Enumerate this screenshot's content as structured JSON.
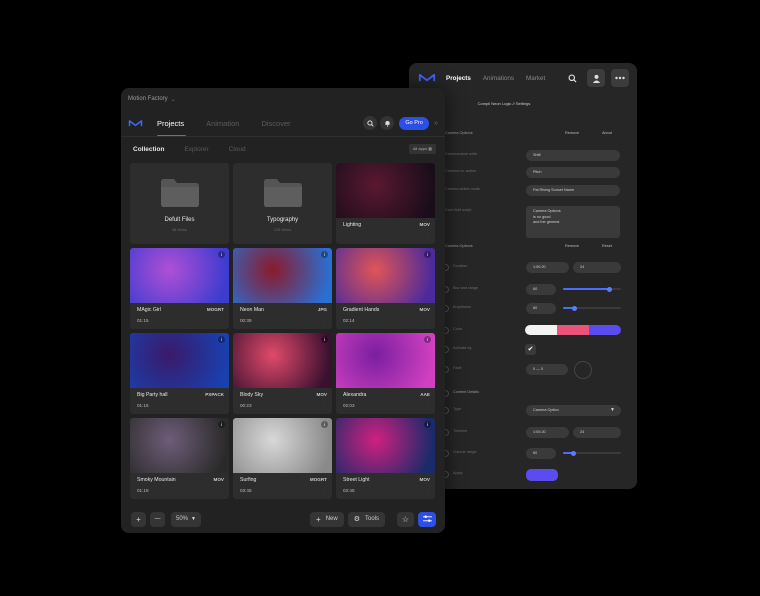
{
  "back_window": {
    "nav": {
      "projects": "Projects",
      "animations": "Animations",
      "market": "Market"
    },
    "subtitle": "Compil Neon Logic // Settings",
    "section1": {
      "title": "Camera Options",
      "tab_a": "Remove",
      "tab_b": "About"
    },
    "fields": [
      {
        "label": "Cameraname write",
        "value": "Shift"
      },
      {
        "label": "Camera no. active",
        "value": "Pitch"
      },
      {
        "label": "Camera active mode",
        "value": "Pal Rising Sunset Name"
      }
    ],
    "textarea": {
      "label": "Cam hold script",
      "lines": [
        "Camera Options",
        "is no good",
        "and the general"
      ]
    },
    "section2": {
      "title": "Camera Options",
      "tab_a": "Remove",
      "tab_b": "Reset"
    },
    "duration": {
      "label": "Duration",
      "a": "1:00:20",
      "b": "24"
    },
    "sliders": [
      {
        "label": "Blur and range",
        "value": "60",
        "fill": 0.8
      },
      {
        "label": "Brightness",
        "value": "60",
        "fill": 0.2
      }
    ],
    "color_label": "Color",
    "swatch_colors": [
      "#f3f3f3",
      "#e9557a",
      "#5a4cf0"
    ],
    "check_label": "Activate by",
    "check_mark": "✔",
    "fade_label": "Fade",
    "fade_value": "0 — 0",
    "section3": {
      "title": "Content Details"
    },
    "type": {
      "label": "Type",
      "value": "Camera Option"
    },
    "timeline": {
      "label": "Timeline",
      "a": "1:00:20",
      "b": "24"
    },
    "slider3": {
      "label": "Volume range",
      "value": "60",
      "fill": 0.18
    },
    "apply_label": "Apply"
  },
  "front_window": {
    "title": "Motion Factory",
    "tabs": {
      "projects": "Projects",
      "animation": "Animation",
      "discover": "Discover"
    },
    "go_pro": "Go Pro",
    "subtabs": {
      "collection": "Collection",
      "explorer": "Explorer",
      "cloud": "Cloud"
    },
    "all_apps": "All apps",
    "folders": [
      {
        "name": "Defult Files",
        "count": "48 Items"
      },
      {
        "name": "Typography",
        "count": "128 Items"
      }
    ],
    "items": [
      {
        "title": "Lighting",
        "format": "MOV",
        "duration": "",
        "c1": "#5a1830",
        "c2": "#1a0d1a"
      },
      {
        "title": "MAgic Girl",
        "format": "MOGRT",
        "duration": "01:15",
        "c1": "#b04fd6",
        "c2": "#3d3ccf"
      },
      {
        "title": "Neon Man",
        "format": "JPG",
        "duration": "00:39",
        "c1": "#8c1a2a",
        "c2": "#2a6fd1"
      },
      {
        "title": "Gradient Hands",
        "format": "MOV",
        "duration": "02:14",
        "c1": "#e05555",
        "c2": "#4a2a9c"
      },
      {
        "title": "Big Party hall",
        "format": "PXPACK",
        "duration": "01:15",
        "c1": "#3a1a6a",
        "c2": "#1a3fae"
      },
      {
        "title": "Blody Sky",
        "format": "MOV",
        "duration": "00:23",
        "c1": "#e04a6a",
        "c2": "#3a1030"
      },
      {
        "title": "Alexandra",
        "format": "AAE",
        "duration": "02:03",
        "c1": "#7a1fa0",
        "c2": "#d040c0"
      },
      {
        "title": "Smoky Mountain",
        "format": "MOV",
        "duration": "01:18",
        "c1": "#6e5d78",
        "c2": "#2a2a2a"
      },
      {
        "title": "Surfing",
        "format": "MOGRT",
        "duration": "03:45",
        "c1": "#d8d8d8",
        "c2": "#8a8a8a"
      },
      {
        "title": "Street Light",
        "format": "MOV",
        "duration": "03:45",
        "c1": "#d02080",
        "c2": "#1a2a6a"
      }
    ],
    "info_glyph": "i",
    "more_glyph": "...",
    "footer": {
      "plus": "+",
      "minus": "—",
      "zoom": "50%",
      "new_label": "New",
      "tools_label": "Tools"
    }
  }
}
